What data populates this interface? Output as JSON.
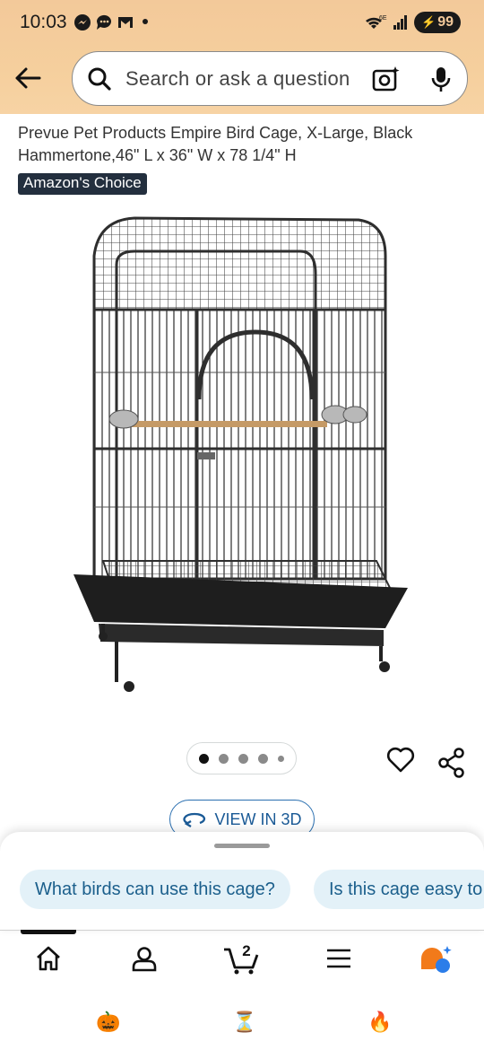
{
  "status_bar": {
    "time": "10:03",
    "network": "6E",
    "battery": "99",
    "icons": [
      "messenger-icon",
      "chat-icon",
      "gmail-icon",
      "dot-icon",
      "wifi-icon",
      "signal-icon",
      "battery-icon"
    ]
  },
  "header": {
    "back_icon": "arrow-left-icon",
    "search_placeholder": "Search or ask a question",
    "camera_icon": "camera-search-icon",
    "mic_icon": "mic-icon"
  },
  "product": {
    "title": "Prevue Pet Products Empire Bird Cage, X-Large, Black Hammertone,46\" L x 36\" W x 78 1/4\" H",
    "badge": "Amazon's Choice",
    "image_icon": "bird-cage-image",
    "carousel": {
      "count": 5,
      "active": 1
    },
    "view_3d": "VIEW IN 3D"
  },
  "questions": {
    "chips": [
      "What birds can use this cage?",
      "Is this cage easy to"
    ]
  },
  "bottom_nav": {
    "items": [
      "home-icon",
      "account-icon",
      "cart-icon",
      "menu-icon",
      "rufus-ai-icon"
    ],
    "cart_count": "2"
  },
  "system_bar": {
    "icons": [
      "pumpkin-icon",
      "hourglass-icon",
      "flame-icon"
    ],
    "glyphs": [
      "🎃",
      "⏳",
      "🔥"
    ]
  },
  "colors": {
    "header_bg": "#f3c99a",
    "badge_bg": "#232f3e",
    "chip_bg": "#e3f1f8",
    "link_blue": "#1a5a96",
    "rufus_orange": "#f27a1a",
    "rufus_blue": "#2b7de9"
  }
}
